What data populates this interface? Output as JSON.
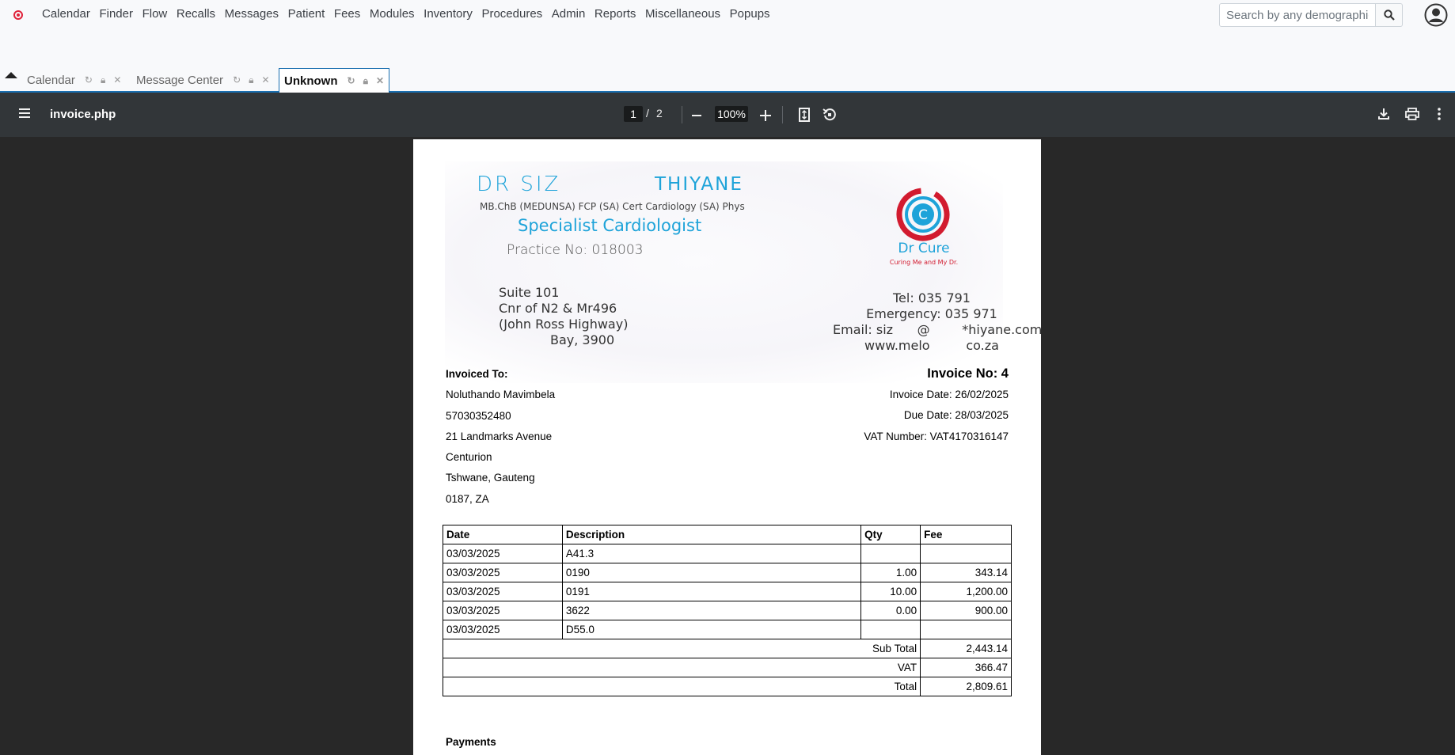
{
  "nav": {
    "items": [
      "Calendar",
      "Finder",
      "Flow",
      "Recalls",
      "Messages",
      "Patient",
      "Fees",
      "Modules",
      "Inventory",
      "Procedures",
      "Admin",
      "Reports",
      "Miscellaneous",
      "Popups"
    ],
    "search_placeholder": "Search by any demographics"
  },
  "tabs": [
    {
      "label": "Calendar",
      "active": false
    },
    {
      "label": "Message Center",
      "active": false
    },
    {
      "label": "Unknown",
      "active": true
    }
  ],
  "pdf": {
    "filename": "invoice.php",
    "current_page": "1",
    "page_separator": "/",
    "total_pages": "2",
    "zoom": "100%"
  },
  "letterhead": {
    "name_part1": "DR SIZ",
    "name_part2": "THIYANE",
    "qualifications": "MB.ChB (MEDUNSA) FCP (SA) Cert Cardiology (SA) Phys",
    "specialty": "Specialist Cardiologist",
    "practice_no": "Practice No: 018003",
    "address": [
      "Suite 101",
      "Cnr of N2 & Mr496",
      "(John Ross Highway)",
      "Bay, 3900"
    ],
    "contact": [
      "Tel: 035 791",
      "Emergency: 035 971",
      "Email: siz      @        *hiyane.com",
      "www.melo         co.za"
    ],
    "logo_name": "Dr Cure",
    "logo_tagline": "Curing Me and My Dr.",
    "colors": {
      "blue": "#1ea3d9",
      "red": "#d21b2f"
    }
  },
  "invoice": {
    "to_heading": "Invoiced To:",
    "patient": [
      "Noluthando Mavimbela",
      "57030352480",
      "21 Landmarks Avenue",
      "Centurion",
      "Tshwane, Gauteng",
      "0187, ZA"
    ],
    "number": "Invoice No: 4",
    "date": "Invoice Date: 26/02/2025",
    "due": "Due Date: 28/03/2025",
    "vat_number": "VAT Number: VAT4170316147",
    "columns": [
      "Date",
      "Description",
      "Qty",
      "Fee"
    ],
    "rows": [
      {
        "date": "03/03/2025",
        "desc": "A41.3",
        "qty": "",
        "fee": ""
      },
      {
        "date": "03/03/2025",
        "desc": "0190",
        "qty": "1.00",
        "fee": "343.14"
      },
      {
        "date": "03/03/2025",
        "desc": "0191",
        "qty": "10.00",
        "fee": "1,200.00"
      },
      {
        "date": "03/03/2025",
        "desc": "3622",
        "qty": "0.00",
        "fee": "900.00"
      },
      {
        "date": "03/03/2025",
        "desc": "D55.0",
        "qty": "",
        "fee": ""
      }
    ],
    "subtotal_label": "Sub Total",
    "subtotal": "2,443.14",
    "vat_label": "VAT",
    "vat": "366.47",
    "total_label": "Total",
    "total": "2,809.61",
    "payments_heading": "Payments"
  }
}
